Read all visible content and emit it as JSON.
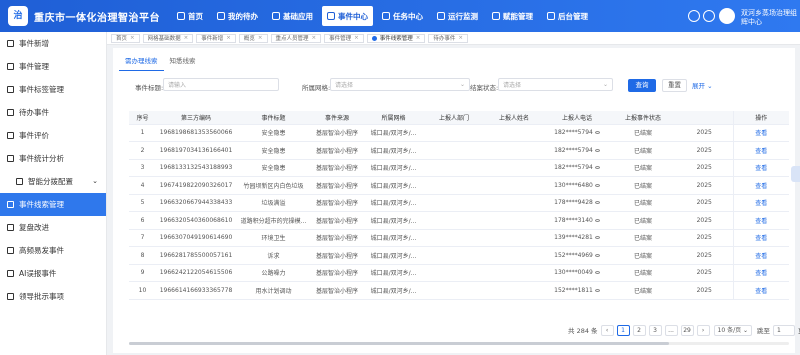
{
  "app": {
    "logo_text": "治",
    "title": "重庆市一体化治理智治平台"
  },
  "nav": [
    {
      "label": "首页",
      "active": false
    },
    {
      "label": "我的待办",
      "active": false
    },
    {
      "label": "基础应用",
      "active": false
    },
    {
      "label": "事件中心",
      "active": true
    },
    {
      "label": "任务中心",
      "active": false
    },
    {
      "label": "运行监测",
      "active": false
    },
    {
      "label": "赋能管理",
      "active": false
    },
    {
      "label": "后台管理",
      "active": false
    }
  ],
  "user": {
    "name": "双河乡蒸场治理组",
    "role": "辉中心"
  },
  "sidebar": [
    {
      "label": "事件新增",
      "active": false,
      "indent": false
    },
    {
      "label": "事件管理",
      "active": false,
      "indent": false
    },
    {
      "label": "事件标签管理",
      "active": false,
      "indent": false
    },
    {
      "label": "待办事件",
      "active": false,
      "indent": false
    },
    {
      "label": "事件评价",
      "active": false,
      "indent": false
    },
    {
      "label": "事件统计分析",
      "active": false,
      "indent": false
    },
    {
      "label": "智能分拨配置",
      "active": false,
      "indent": true,
      "chevron": "⌄"
    },
    {
      "label": "事件线索管理",
      "active": true,
      "indent": false
    },
    {
      "label": "复盘改进",
      "active": false,
      "indent": false
    },
    {
      "label": "高频易发事件",
      "active": false,
      "indent": false
    },
    {
      "label": "AI误报事件",
      "active": false,
      "indent": false
    },
    {
      "label": "领导批示事项",
      "active": false,
      "indent": false
    }
  ],
  "tabs": [
    {
      "label": "首页",
      "active": false
    },
    {
      "label": "网格基础数据",
      "active": false
    },
    {
      "label": "事件新增",
      "active": false
    },
    {
      "label": "概览",
      "active": false
    },
    {
      "label": "重点人员管理",
      "active": false
    },
    {
      "label": "事件管理",
      "active": false
    },
    {
      "label": "事件线索管理",
      "active": true
    },
    {
      "label": "待办事件",
      "active": false
    }
  ],
  "subtabs": [
    {
      "label": "需办理线索",
      "active": true
    },
    {
      "label": "知悉线索",
      "active": false
    }
  ],
  "filters": {
    "title_label": "事件标题:",
    "title_placeholder": "请输入",
    "grid_label": "所属网格:",
    "grid_placeholder": "请选择",
    "status_label": "结案状态:",
    "status_placeholder": "请选择",
    "search_btn": "查询",
    "reset_btn": "重置",
    "expand": "展开 ⌄"
  },
  "table": {
    "headers": [
      "序号",
      "第三方编码",
      "事件标题",
      "事件来源",
      "所属网格",
      "上报人部门",
      "上报人姓名",
      "上报人电话",
      "上报事件状态",
      "",
      "操作"
    ],
    "rows": [
      [
        "1",
        "1968198681353560066",
        "安全隐患",
        "基层智治小程序",
        "城口县/双河乡/...",
        "",
        "",
        "182****5794",
        "已结案",
        "2025",
        "查看"
      ],
      [
        "2",
        "1968197034136166401",
        "安全隐患",
        "基层智治小程序",
        "城口县/双河乡/...",
        "",
        "",
        "182****5794",
        "已结案",
        "2025",
        "查看"
      ],
      [
        "3",
        "1968133132543188993",
        "安全隐患",
        "基层智治小程序",
        "城口县/双河乡/...",
        "",
        "",
        "182****5794",
        "已结案",
        "2025",
        "查看"
      ],
      [
        "4",
        "1967419822090326017",
        "竹园坝新区内白色垃圾",
        "基层智治小程序",
        "城口县/双河乡/...",
        "",
        "",
        "130****6480",
        "已结案",
        "2025",
        "查看"
      ],
      [
        "5",
        "1966320667944338433",
        "垃圾满溢",
        "基层智治小程序",
        "城口县/双河乡/...",
        "",
        "",
        "178****9428",
        "已结案",
        "2025",
        "查看"
      ],
      [
        "6",
        "1966320540360068610",
        "道路积分超市的完操模...",
        "基层智治小程序",
        "城口县/双河乡/...",
        "",
        "",
        "178****3140",
        "已结案",
        "2025",
        "查看"
      ],
      [
        "7",
        "1966307049190614690",
        "环境卫生",
        "基层智治小程序",
        "城口县/双河乡/...",
        "",
        "",
        "139****4281",
        "已结案",
        "2025",
        "查看"
      ],
      [
        "8",
        "1966281785500057161",
        "诉求",
        "基层智治小程序",
        "城口县/双河乡/...",
        "",
        "",
        "152****4969",
        "已结案",
        "2025",
        "查看"
      ],
      [
        "9",
        "1966242122054615506",
        "公路噪力",
        "基层智治小程序",
        "城口县/双河乡/...",
        "",
        "",
        "130****0049",
        "已结案",
        "2025",
        "查看"
      ],
      [
        "10",
        "1966614166933365778",
        "用水计划调动",
        "基层智治小程序",
        "城口县/双河乡/...",
        "",
        "",
        "152****1811",
        "已结案",
        "2025",
        "查看"
      ]
    ]
  },
  "pagination": {
    "total": "共 284 条",
    "prev": "‹",
    "pages": [
      "1",
      "2",
      "3",
      "...",
      "29"
    ],
    "current": "1",
    "next": "›",
    "page_size": "10 条/页 ⌄",
    "goto_label": "跳至",
    "goto_value": "1",
    "page_unit": "页"
  },
  "colors": {
    "primary": "#1f6ae6",
    "topbar": "#1f5fd6",
    "active_sidebar": "#2f78ec"
  }
}
